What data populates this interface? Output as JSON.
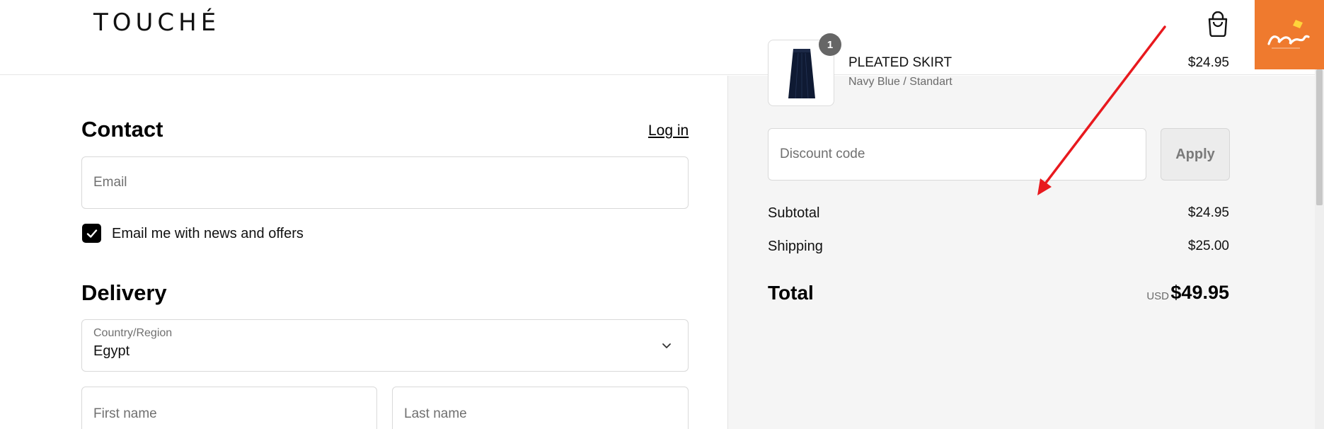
{
  "header": {
    "logo": "TOUCHÉ",
    "cart_icon": "shopping-bag-icon",
    "watermark_text": "المخفض"
  },
  "contact": {
    "title": "Contact",
    "login_link": "Log in",
    "email_placeholder": "Email",
    "newsletter_label": "Email me with news and offers",
    "newsletter_checked": true
  },
  "delivery": {
    "title": "Delivery",
    "country_label": "Country/Region",
    "country_value": "Egypt",
    "first_name_placeholder": "First name",
    "last_name_placeholder": "Last name"
  },
  "order": {
    "item": {
      "name": "PLEATED SKIRT",
      "variant": "Navy Blue / Standart",
      "price": "$24.95",
      "quantity": "1"
    },
    "discount_placeholder": "Discount code",
    "apply_label": "Apply",
    "subtotal_label": "Subtotal",
    "subtotal_value": "$24.95",
    "shipping_label": "Shipping",
    "shipping_value": "$25.00",
    "total_label": "Total",
    "total_currency": "USD",
    "total_value": "$49.95"
  },
  "colors": {
    "watermark_bg": "#ef7a2e",
    "annotation_arrow": "#e8191e",
    "summary_bg": "#f5f5f5"
  }
}
